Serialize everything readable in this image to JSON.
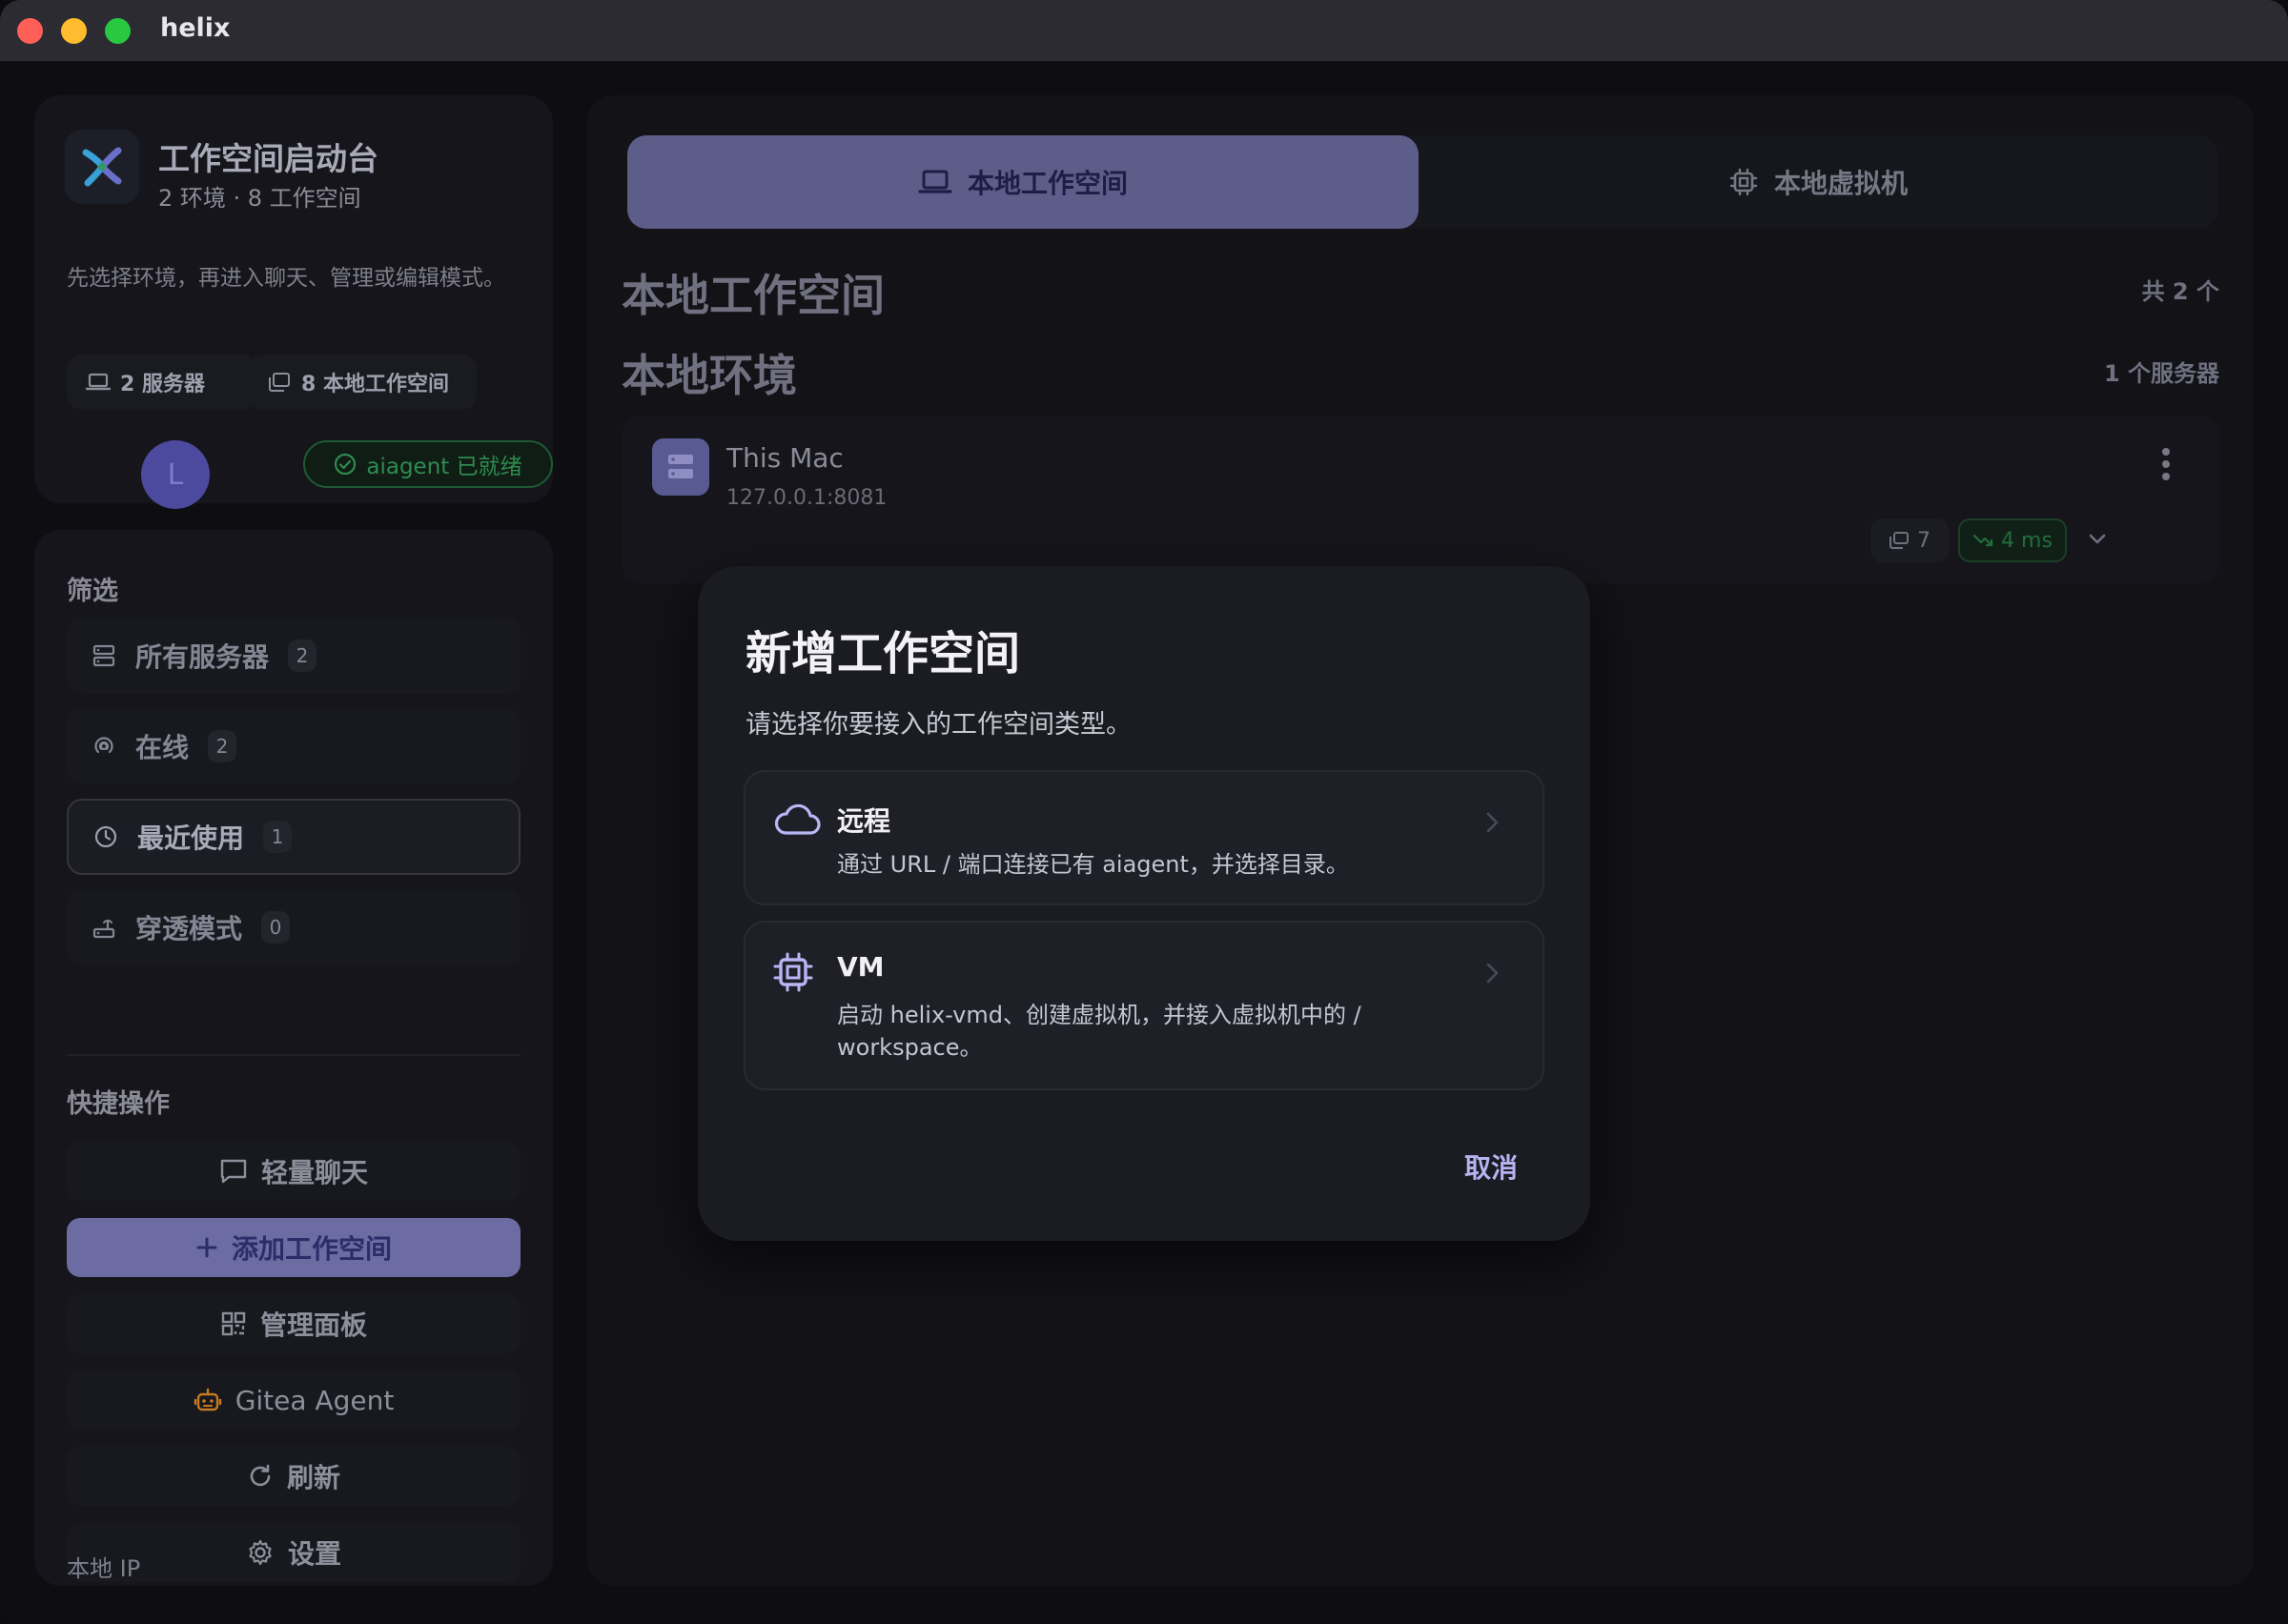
{
  "window": {
    "title": "helix"
  },
  "sidebar": {
    "workspace": {
      "title": "工作空间启动台",
      "subtitle": "2 环境 · 8 工作空间",
      "description": "先选择环境，再进入聊天、管理或编辑模式。",
      "servers_chip": "2 服务器",
      "workspaces_chip": "8 本地工作空间",
      "avatar_initial": "L",
      "ready_badge": "aiagent 已就绪"
    },
    "filter_label": "筛选",
    "filters": [
      {
        "label": "所有服务器",
        "count": "2"
      },
      {
        "label": "在线",
        "count": "2"
      },
      {
        "label": "最近使用",
        "count": "1"
      },
      {
        "label": "穿透模式",
        "count": "0"
      }
    ],
    "quick_actions_label": "快捷操作",
    "quick_actions": [
      {
        "label": "轻量聊天"
      },
      {
        "label": "添加工作空间"
      },
      {
        "label": "管理面板"
      },
      {
        "label": "Gitea Agent"
      },
      {
        "label": "刷新"
      },
      {
        "label": "设置"
      }
    ],
    "local_ip_label": "本地 IP"
  },
  "main": {
    "tabs": [
      {
        "label": "本地工作空间",
        "active": true
      },
      {
        "label": "本地虚拟机",
        "active": false
      }
    ],
    "heading": "本地工作空间",
    "total": "共 2 个",
    "env_heading": "本地环境",
    "server_count": "1 个服务器",
    "server": {
      "name": "This Mac",
      "address": "127.0.0.1:8081",
      "workspace_count": "7",
      "latency": "4 ms"
    }
  },
  "modal": {
    "title": "新增工作空间",
    "description": "请选择你要接入的工作空间类型。",
    "options": [
      {
        "title": "远程",
        "description": "通过 URL / 端口连接已有 aiagent，并选择目录。"
      },
      {
        "title": "VM",
        "description": "启动 helix-vmd、创建虚拟机，并接入虚拟机中的 / workspace。"
      }
    ],
    "cancel_label": "取消"
  },
  "colors": {
    "accent": "#6c6ca3",
    "ready_green": "#2f8b4f",
    "cancel_text": "#b6b4f0"
  }
}
